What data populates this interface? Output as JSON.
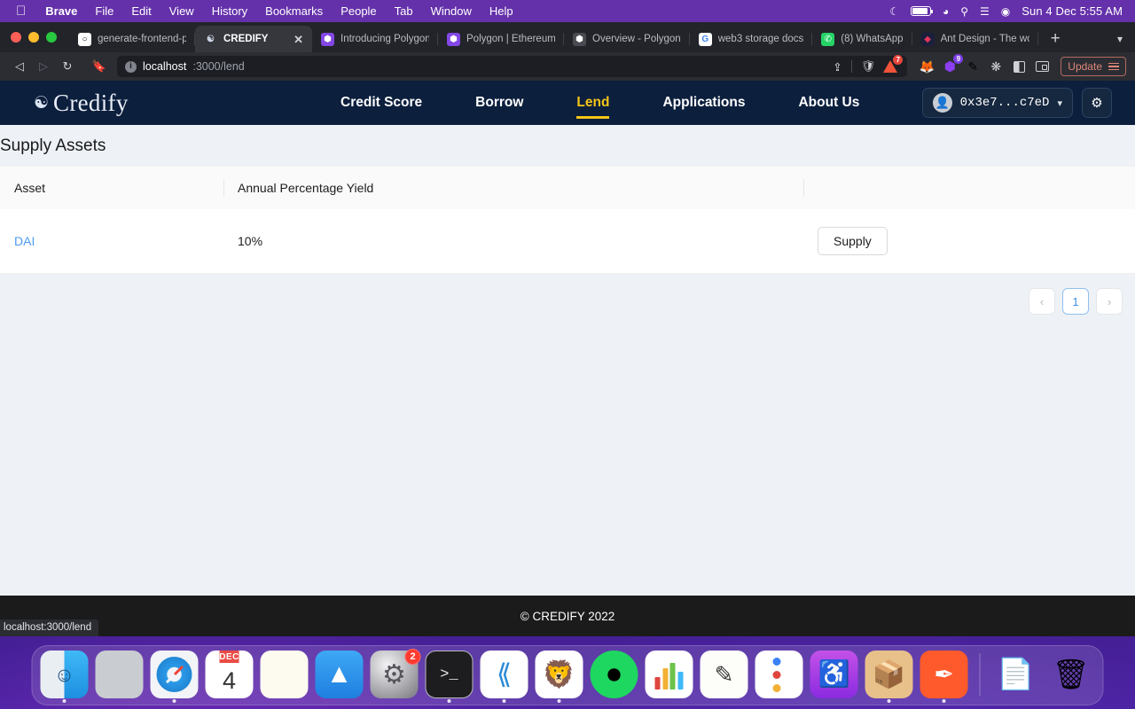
{
  "menubar": {
    "apple_icon": "apple-icon",
    "items": [
      {
        "label": "Brave",
        "bold": true
      },
      {
        "label": "File",
        "bold": false
      },
      {
        "label": "Edit",
        "bold": false
      },
      {
        "label": "View",
        "bold": false
      },
      {
        "label": "History",
        "bold": false
      },
      {
        "label": "Bookmarks",
        "bold": false
      },
      {
        "label": "People",
        "bold": false
      },
      {
        "label": "Tab",
        "bold": false
      },
      {
        "label": "Window",
        "bold": false
      },
      {
        "label": "Help",
        "bold": false
      }
    ],
    "status_icons": [
      "moon-icon",
      "battery-icon",
      "wifi-icon",
      "search-icon",
      "control-center-icon",
      "siri-icon"
    ],
    "clock": "Sun 4 Dec  5:55 AM"
  },
  "browser": {
    "tabs": [
      {
        "title": "generate-frontend-p",
        "favicon": "github-icon",
        "active": false
      },
      {
        "title": "CREDIFY",
        "favicon": "credify-icon",
        "active": true
      },
      {
        "title": "Introducing Polygon",
        "favicon": "polygon-icon",
        "active": false
      },
      {
        "title": "Polygon | Ethereum's",
        "favicon": "polygon-icon",
        "active": false
      },
      {
        "title": "Overview - Polygon",
        "favicon": "polygon-docs-icon",
        "active": false
      },
      {
        "title": "web3 storage docs",
        "favicon": "google-icon",
        "active": false
      },
      {
        "title": "(8) WhatsApp",
        "favicon": "whatsapp-icon",
        "active": false
      },
      {
        "title": "Ant Design - The wo",
        "favicon": "antdesign-icon",
        "active": false
      }
    ],
    "new_tab_label": "+",
    "tab_list_chevron": "chevron-down-icon",
    "nav": {
      "back": "back-arrow-icon",
      "forward": "forward-arrow-icon",
      "reload": "reload-icon",
      "bookmark": "bookmark-icon"
    },
    "omnibox": {
      "info_icon": "info-icon",
      "host": "localhost",
      "path": ":3000/lend"
    },
    "toolbar_right": {
      "share_icon": "share-icon",
      "brave_shields_icon": "brave-shield-icon",
      "brave_rewards_icon": "brave-rewards-icon",
      "brave_rewards_count": "7",
      "metamask_icon": "metamask-fox-icon",
      "wallet_ext_icon": "wallet-extension-icon",
      "wallet_ext_count": "9",
      "pen_ext_icon": "pen-extension-icon",
      "extensions_icon": "puzzle-icon",
      "sidebar_icon": "sidebar-panel-icon",
      "brave_wallet_icon": "brave-wallet-icon",
      "update_label": "Update",
      "menu_icon": "hamburger-menu-icon"
    },
    "status_bubble": "localhost:3000/lend"
  },
  "app": {
    "logo": {
      "glyph": "credify-mark-icon",
      "word": "Credify"
    },
    "nav_links": [
      {
        "label": "Credit Score",
        "active": false
      },
      {
        "label": "Borrow",
        "active": false
      },
      {
        "label": "Lend",
        "active": true
      },
      {
        "label": "Applications",
        "active": false
      },
      {
        "label": "About Us",
        "active": false
      }
    ],
    "wallet": {
      "avatar_icon": "user-avatar-icon",
      "address": "0x3e7...c7eD",
      "chevron": "chevron-down-icon"
    },
    "settings_icon": "gear-icon",
    "page_title": "Supply Assets",
    "table": {
      "columns": [
        "Asset",
        "Annual Percentage Yield",
        ""
      ],
      "rows": [
        {
          "asset": "DAI",
          "apy": "10%",
          "action": "Supply"
        }
      ]
    },
    "pagination": {
      "prev_icon": "chevron-left-icon",
      "pages": [
        "1"
      ],
      "current": "1",
      "next_icon": "chevron-right-icon"
    },
    "footer": "© CREDIFY 2022",
    "colors": {
      "nav_background": "#0c1f3d",
      "accent": "#f5c518",
      "link": "#4e9bf0",
      "page_background": "#eef1f5",
      "footer_background": "#1b1b1b"
    }
  },
  "dock": {
    "items": [
      {
        "name": "finder",
        "label": "Finder",
        "running": true,
        "badge": null
      },
      {
        "name": "launchpad",
        "label": "Launchpad",
        "running": false,
        "badge": null
      },
      {
        "name": "safari",
        "label": "Safari",
        "running": true,
        "badge": null
      },
      {
        "name": "calendar",
        "label": "Calendar",
        "running": false,
        "badge": null,
        "month": "DEC",
        "day": "4"
      },
      {
        "name": "notes",
        "label": "Notes",
        "running": false,
        "badge": null
      },
      {
        "name": "app-store",
        "label": "App Store",
        "running": false,
        "badge": null
      },
      {
        "name": "system-preferences",
        "label": "System Preferences",
        "running": false,
        "badge": "2"
      },
      {
        "name": "terminal",
        "label": "Terminal",
        "running": true,
        "badge": null
      },
      {
        "name": "vscode",
        "label": "Visual Studio Code",
        "running": true,
        "badge": null
      },
      {
        "name": "brave",
        "label": "Brave Browser",
        "running": true,
        "badge": null
      },
      {
        "name": "spotify",
        "label": "Spotify",
        "running": false,
        "badge": null
      },
      {
        "name": "numbers",
        "label": "Numbers",
        "running": false,
        "badge": null
      },
      {
        "name": "keynote",
        "label": "Keynote",
        "running": false,
        "badge": null
      },
      {
        "name": "reminders",
        "label": "Reminders",
        "running": false,
        "badge": null
      },
      {
        "name": "podcasts",
        "label": "Podcasts",
        "running": false,
        "badge": null
      },
      {
        "name": "package",
        "label": "Package",
        "running": true,
        "badge": null
      },
      {
        "name": "sketch",
        "label": "Sketch",
        "running": true,
        "badge": null
      }
    ],
    "right_items": [
      {
        "name": "documents",
        "label": "Documents"
      },
      {
        "name": "trash",
        "label": "Trash"
      }
    ]
  }
}
